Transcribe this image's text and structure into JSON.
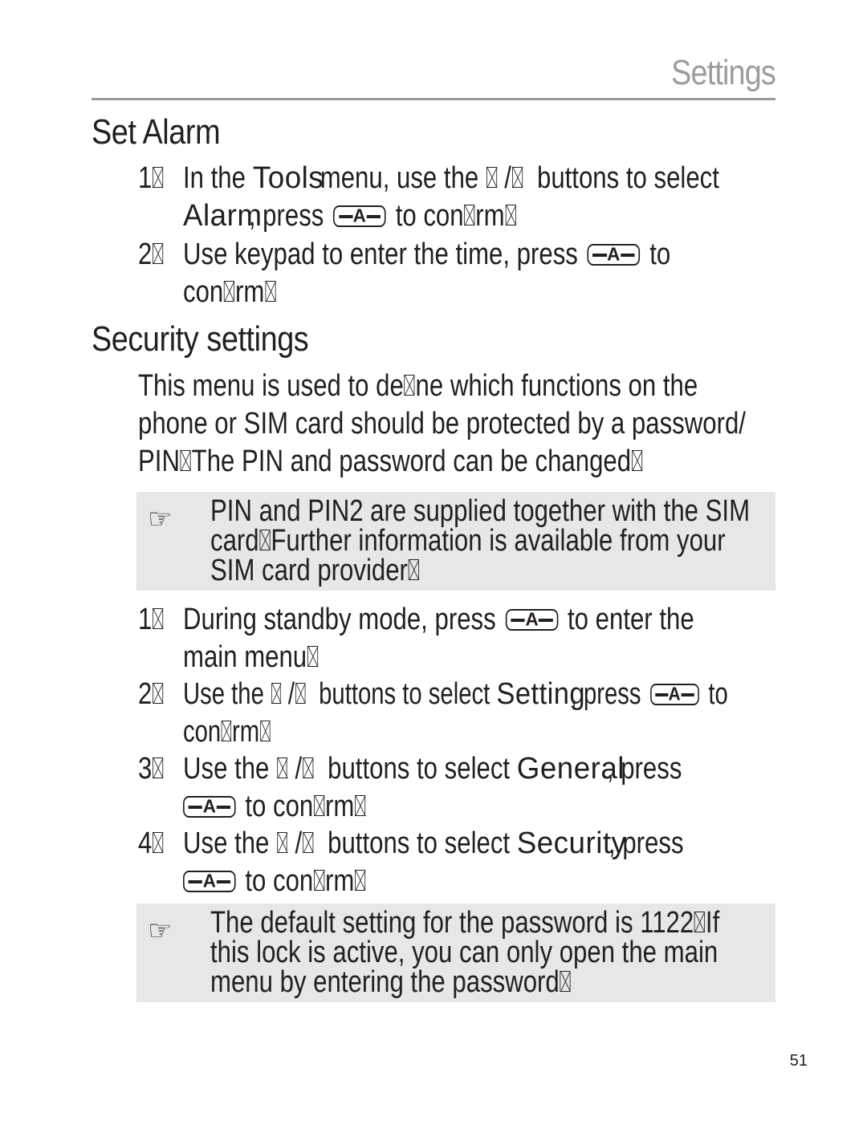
{
  "header": {
    "section_title": "Settings"
  },
  "set_alarm": {
    "heading": "Set Alarm",
    "steps": [
      {
        "num": "1",
        "line1_a": "In the ",
        "line1_term": "Tools",
        "line1_b": "menu, use  the",
        "line1_c": "buttons to select",
        "line2_term": "Alarm",
        "line2_a": ", press",
        "line2_b": "to con",
        "line2_c": "rm"
      },
      {
        "num": "2",
        "line1_a": "Use keypad to enter the time, press",
        "line1_b": "to",
        "line2_a": "con",
        "line2_b": "rm"
      }
    ]
  },
  "security": {
    "heading": "Security settings",
    "intro_lines": [
      [
        "This menu is used to de",
        "ne which functions on the"
      ],
      [
        "phone or SIM card should be protected by a password/"
      ],
      [
        "PIN",
        "The PIN and password can be changed",
        ""
      ]
    ],
    "note1_lines": [
      [
        "PIN and PIN2 are supplied together with the SIM"
      ],
      [
        "card",
        "Further information is available from your"
      ],
      [
        "SIM card provider",
        ""
      ]
    ],
    "steps": [
      {
        "num": "1",
        "line1_a": "During standby mode, press",
        "line1_b": "to enter the",
        "line2_a": "main menu"
      },
      {
        "num": "2",
        "line1_a": "Use the",
        "line1_b": "buttons to select",
        "term": "Setting",
        "line1_c": ", press",
        "line1_d": "to",
        "line2_a": "con",
        "line2_b": "rm"
      },
      {
        "num": "3",
        "line1_a": "Use the",
        "line1_b": "buttons to select",
        "term": "General",
        "line1_c": ", press",
        "line2_a": "to con",
        "line2_b": "rm"
      },
      {
        "num": "4",
        "line1_a": "Use the",
        "line1_b": "buttons to select",
        "term": "Security",
        "line1_c": ", press",
        "line2_a": "to con",
        "line2_b": "rm"
      }
    ],
    "note2_lines": [
      [
        "The default setting for the password is 1122",
        "If"
      ],
      [
        "this lock is active, you can only open the main"
      ],
      [
        "menu by entering the password",
        ""
      ]
    ]
  },
  "icons": {
    "note_icon": "pointing-hand-icon",
    "key_icon": "select-key-icon",
    "key_label": "A",
    "note_glyph": "☞",
    "slash": "/"
  },
  "footer": {
    "page_number": "51"
  }
}
